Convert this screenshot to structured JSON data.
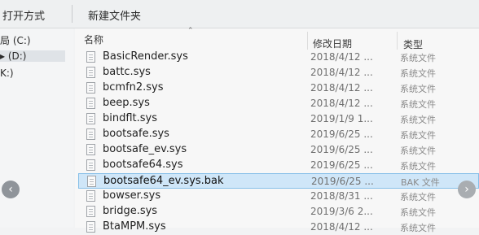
{
  "toolbar": {
    "open_label": "打开方式",
    "new_folder_label": "新建文件夹"
  },
  "nav": {
    "drives": [
      {
        "label": "局 (C:)"
      },
      {
        "label": "▸ (D:)"
      },
      {
        "label": "K:)"
      }
    ]
  },
  "columns": {
    "name": "名称",
    "date": "修改日期",
    "type": "类型"
  },
  "files": [
    {
      "name": "BasicRender.sys",
      "date": "2018/4/12 ...",
      "type": "系统文件"
    },
    {
      "name": "battc.sys",
      "date": "2018/4/12 ...",
      "type": "系统文件"
    },
    {
      "name": "bcmfn2.sys",
      "date": "2018/4/12 ...",
      "type": "系统文件"
    },
    {
      "name": "beep.sys",
      "date": "2018/4/12 ...",
      "type": "系统文件"
    },
    {
      "name": "bindflt.sys",
      "date": "2019/1/9 1...",
      "type": "系统文件"
    },
    {
      "name": "bootsafe.sys",
      "date": "2019/6/25 ...",
      "type": "系统文件"
    },
    {
      "name": "bootsafe_ev.sys",
      "date": "2019/6/25 ...",
      "type": "系统文件"
    },
    {
      "name": "bootsafe64.sys",
      "date": "2019/6/25 ...",
      "type": "系统文件"
    },
    {
      "name": "bootsafe64_ev.sys.bak",
      "date": "2019/6/25 ...",
      "type": "BAK 文件"
    },
    {
      "name": "bowser.sys",
      "date": "2018/8/31 ...",
      "type": "系统文件"
    },
    {
      "name": "bridge.sys",
      "date": "2019/3/6 2...",
      "type": "系统文件"
    },
    {
      "name": "BtaMPM.sys",
      "date": "2018/4/12 ...",
      "type": "系统文件"
    }
  ],
  "selected_index": 8
}
